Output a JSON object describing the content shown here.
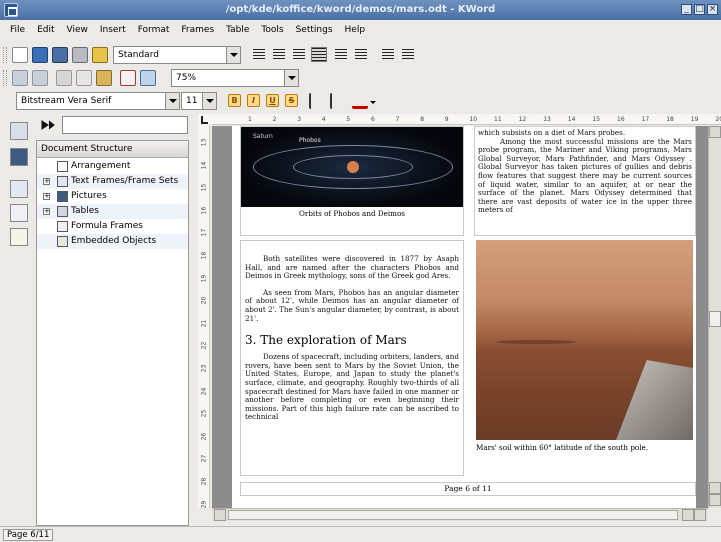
{
  "window": {
    "title": "/opt/kde/koffice/kword/demos/mars.odt - KWord"
  },
  "menu": [
    "File",
    "Edit",
    "View",
    "Insert",
    "Format",
    "Frames",
    "Table",
    "Tools",
    "Settings",
    "Help"
  ],
  "toolbar": {
    "style": "Standard",
    "zoom": "75%",
    "font_family": "Bitstream Vera Serif",
    "font_size": "11",
    "fmt_bold": "B",
    "fmt_italic": "I",
    "fmt_underline": "U",
    "fmt_strike": "S"
  },
  "doc_panel": {
    "header": "Document Structure",
    "items": [
      {
        "label": "Arrangement"
      },
      {
        "label": "Text Frames/Frame Sets"
      },
      {
        "label": "Pictures"
      },
      {
        "label": "Tables"
      },
      {
        "label": "Formula Frames"
      },
      {
        "label": "Embedded Objects"
      }
    ]
  },
  "ruler": {
    "top": [
      "1",
      "2",
      "3",
      "4",
      "5",
      "6",
      "7",
      "8",
      "9",
      "10",
      "11",
      "12",
      "13",
      "14",
      "15",
      "16",
      "17",
      "18",
      "19",
      "20"
    ],
    "left": [
      "13",
      "14",
      "15",
      "16",
      "17",
      "18",
      "19",
      "20",
      "21",
      "22",
      "23",
      "24",
      "25",
      "26",
      "27",
      "28",
      "29"
    ]
  },
  "document": {
    "phobos_labels": {
      "saturn": "Saturn",
      "phobos": "Phobos"
    },
    "phobos_caption": "Orbits of Phobos and Deimos",
    "para1": "Both satellites were discovered in 1877 by Asaph Hall, and are named after the characters Phobos and Deimos in Greek mythology, sons of the Greek god Ares.",
    "para2": "As seen from Mars, Phobos has an angular diameter of about 12', while Deimos has an angular diameter of about 2'. The Sun's angular diameter, by contrast, is about 21'.",
    "heading": "3. The exploration of Mars",
    "para3": "Dozens of spacecraft, including orbiters, landers, and rovers, have been sent to Mars by the Soviet Union, the United States, Europe, and Japan to study the planet's surface, climate, and geography. Roughly two-thirds of all spacecraft destined for Mars have failed in one manner or another before completing or even beginning their missions. Part of this high failure rate can be ascribed to technical",
    "right_top": "which subsists on a diet of Mars probes.",
    "right_para": "Among the most successful missions are the Mars probe program, the Mariner and Viking programs, Mars Global Surveyor, Mars Pathfinder, and Mars Odyssey . Global Surveyor has taken pictures of gullies and debris flow features that suggest there may be current sources of liquid water, similar to an aquifer, at or near the surface of the planet. Mars Odyssey determined that there are vast deposits of water ice in the upper three meters of",
    "mars_caption": "Mars' soil within 60° latitude of the south pole.",
    "footer": "Page 6 of 11"
  },
  "status": {
    "page": "Page 6/11"
  },
  "colors": {
    "titlebar": "#5a7fb3",
    "canvas_bg": "#8c8c8c"
  }
}
